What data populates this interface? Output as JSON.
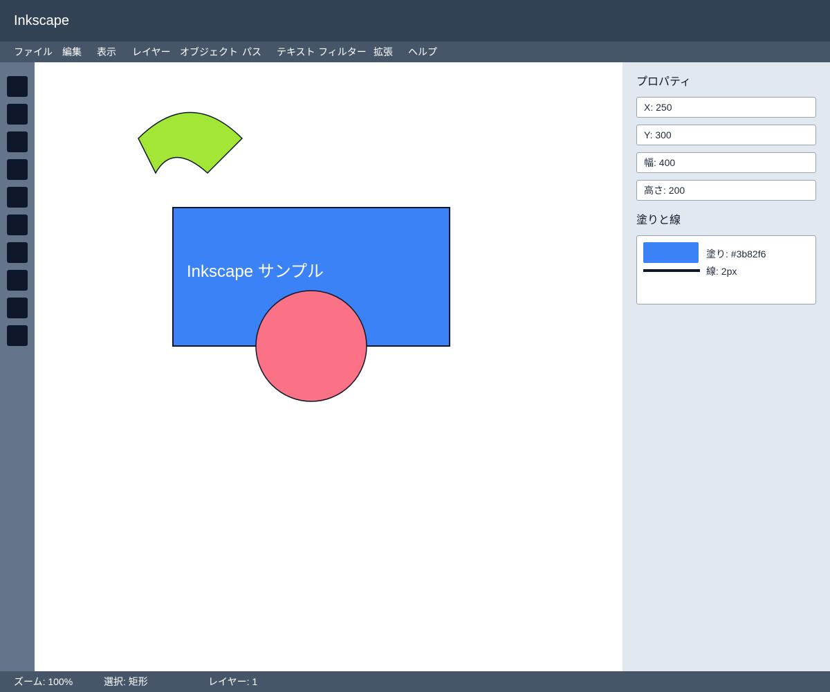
{
  "app": {
    "title": "Inkscape"
  },
  "menu": {
    "items": [
      {
        "label": "ファイル"
      },
      {
        "label": "編集"
      },
      {
        "label": "表示"
      },
      {
        "label": "レイヤー"
      },
      {
        "label": "オブジェクト"
      },
      {
        "label": "パス"
      },
      {
        "label": "テキスト"
      },
      {
        "label": "フィルター"
      },
      {
        "label": "拡張"
      },
      {
        "label": "ヘルプ"
      }
    ]
  },
  "toolbox": {
    "tool_count": 10,
    "button_color": "#0f172a"
  },
  "canvas": {
    "text_object": "Inkscape サンプル",
    "rect_fill": "#3b82f6",
    "circle_fill": "#fb7185",
    "arc_fill": "#a3e635",
    "stroke_color": "#0f172a"
  },
  "properties": {
    "heading": "プロパティ",
    "x_field": "X: 250",
    "y_field": "Y: 300",
    "width_field": "幅: 400",
    "height_field": "高さ: 200"
  },
  "fill_stroke": {
    "heading": "塗りと線",
    "fill_label": "塗り: #3b82f6",
    "stroke_label": "線: 2px",
    "fill_color": "#3b82f6",
    "stroke_color": "#0f172a"
  },
  "status": {
    "zoom": "ズーム: 100%",
    "selection": "選択: 矩形",
    "layer": "レイヤー: 1"
  },
  "colors": {
    "titlebar": "#334155",
    "menubar": "#475569",
    "toolbox": "#64748b",
    "panel": "#e2e8f0"
  }
}
